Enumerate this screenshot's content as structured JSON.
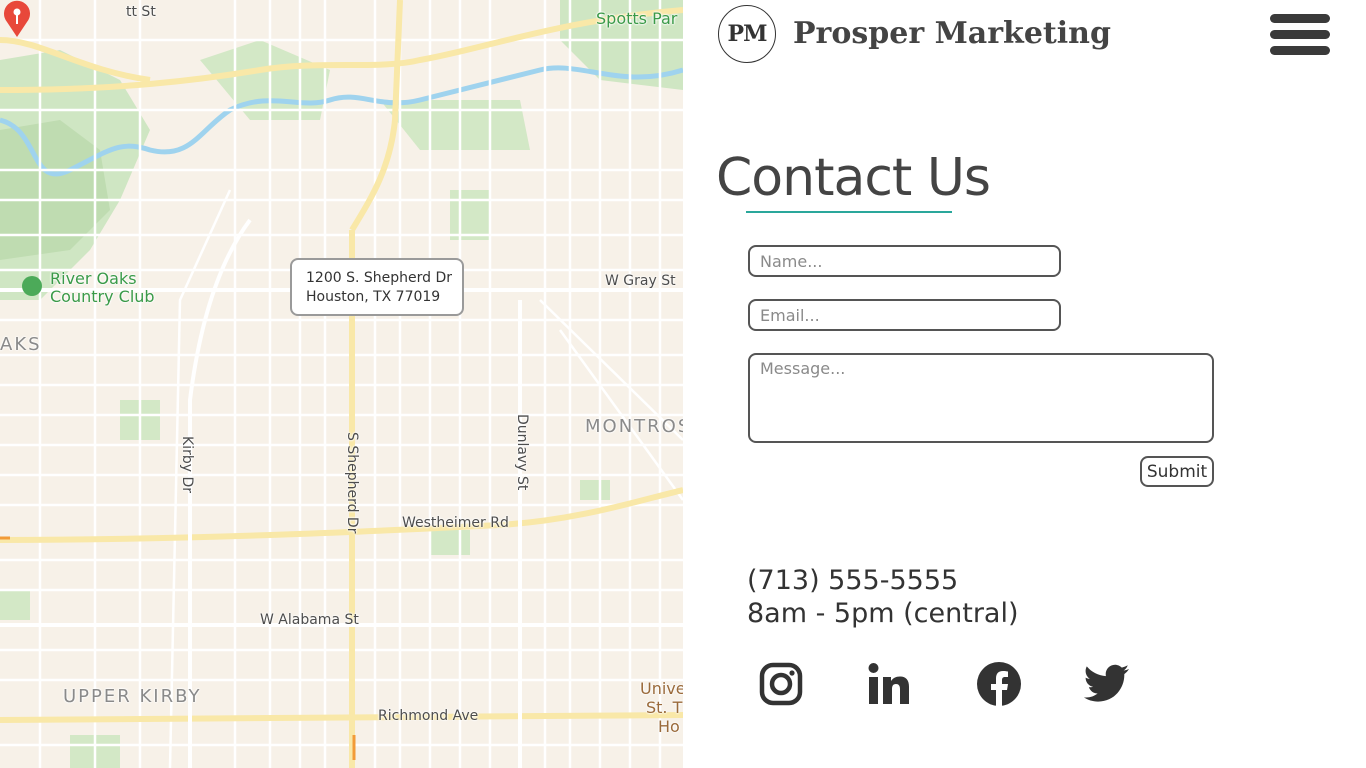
{
  "map": {
    "callout": {
      "line1": "1200 S. Shepherd Dr",
      "line2": "Houston, TX 77019"
    },
    "labels": {
      "street_top": "tt St",
      "park": "Spotts Par",
      "club_line1": "River Oaks",
      "club_line2": "Country Club",
      "area_left": "AKS",
      "w_gray": "W Gray St",
      "montrose": "MONTROS",
      "kirby": "Kirby Dr",
      "shepherd": "S Shepherd Dr",
      "dunlavy": "Dunlavy St",
      "westheimer": "Westheimer Rd",
      "alabama": "W Alabama St",
      "upper_kirby": "UPPER KIRBY",
      "richmond": "Richmond Ave",
      "univ_line1": "Unive",
      "univ_line2": "St. T",
      "univ_line3": "Ho"
    }
  },
  "header": {
    "logo_text": "PM",
    "brand": "Prosper Marketing"
  },
  "contact": {
    "title": "Contact Us",
    "name_placeholder": "Name...",
    "email_placeholder": "Email...",
    "message_placeholder": "Message...",
    "submit_label": "Submit",
    "phone": "(713) 555-5555",
    "hours": "8am - 5pm (central)"
  },
  "colors": {
    "accent": "#2aa79b",
    "text": "#444444",
    "map_bg": "#f7f1e8",
    "pin": "#e8483a"
  },
  "social": [
    "instagram-icon",
    "linkedin-icon",
    "facebook-icon",
    "twitter-icon"
  ]
}
